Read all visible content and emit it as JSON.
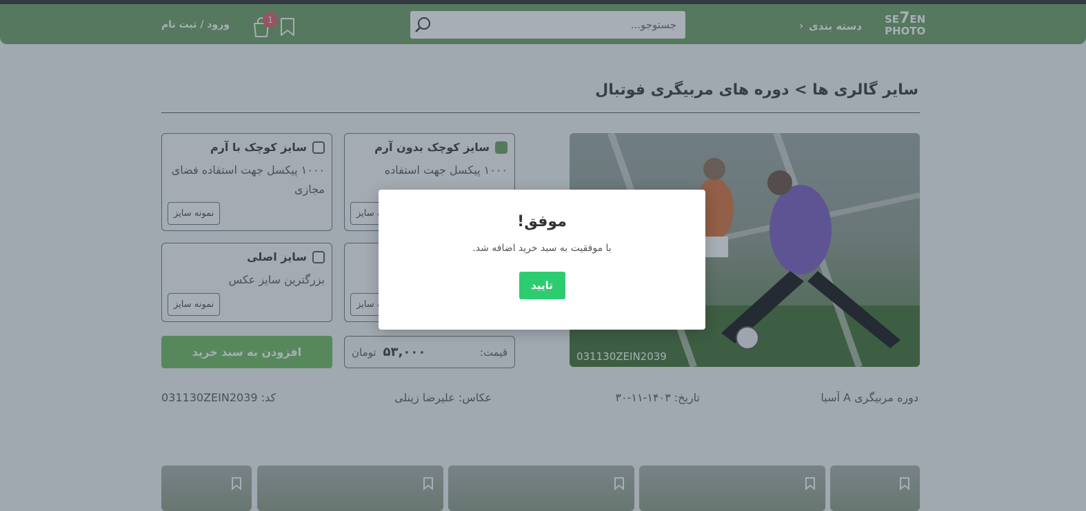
{
  "header": {
    "logo_line1": "SE",
    "logo_seven": "7",
    "logo_line1b": "EN",
    "logo_line2": "PHOTO",
    "categories_label": "دسته بندی",
    "search_placeholder": "جستوجو...",
    "cart_count": "1",
    "login_label": "ورود / ثبت نام",
    "accent": "#6a9d62"
  },
  "breadcrumb": "سایر گالری ها > دوره های مربیگری فوتبال",
  "photo": {
    "code": "031130ZEIN2039"
  },
  "options": [
    {
      "title": "سایز کوچک بدون آرم",
      "desc": "۱۰۰۰ پیکسل جهت استفاده",
      "checked": true,
      "sample": "نمونه سایز"
    },
    {
      "title": "سایز کوچک با آرم",
      "desc": "۱۰۰۰ پیکسل جهت استفاده فضای مجازی",
      "checked": false,
      "sample": "نمونه سایز"
    },
    {
      "title": "",
      "desc": "",
      "checked": false,
      "sample": "نمونه سایز"
    },
    {
      "title": "سایز اصلی",
      "desc": "بزرگترین سایز عکس",
      "checked": false,
      "sample": "نمونه سایز"
    }
  ],
  "price": {
    "label": "قیمت:",
    "value": "۵۳,۰۰۰",
    "currency": "تومان"
  },
  "add_to_cart": "افزودن به سبد خرید",
  "meta": {
    "course": "دوره مربیگری A آسیا",
    "date": "تاریخ: ۱۴۰۳-۱۱-۳۰",
    "photographer": "عکاس: علیرضا زینلی",
    "code": "کد: 031130ZEIN2039"
  },
  "modal": {
    "title": "موفق!",
    "text": "با موفقیت به سبد خرید اضافه شد.",
    "ok": "تایید",
    "ok_color": "#2ecc71"
  }
}
